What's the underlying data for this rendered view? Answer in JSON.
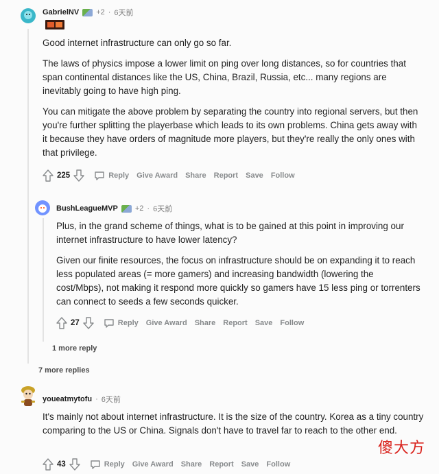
{
  "comments": [
    {
      "username": "GabrielNV",
      "flair_count": "+2",
      "time": "6天前",
      "paragraphs": [
        "Good internet infrastructure can only go so far.",
        "The laws of physics impose a lower limit on ping over long distances, so for countries that span continental distances like the US, China, Brazil, Russia, etc... many regions are inevitably going to have high ping.",
        "You can mitigate the above problem by separating the country into regional servers, but then you're further splitting the playerbase which leads to its own problems. China gets away with it because they have orders of magnitude more players, but they're really the only ones with that privilege."
      ],
      "score": "225"
    },
    {
      "username": "BushLeagueMVP",
      "flair_count": "+2",
      "time": "6天前",
      "paragraphs": [
        "Plus, in the grand scheme of things, what is to be gained at this point in improving our internet infrastructure to have lower latency?",
        "Given our finite resources, the focus on infrastructure should be on expanding it to reach less populated areas (= more gamers) and increasing bandwidth (lowering the cost/Mbps), not making it respond more quickly so gamers have 15 less ping or torrenters can connect to seeds a few seconds quicker."
      ],
      "score": "27"
    },
    {
      "username": "youeatmytofu",
      "time": "6天前",
      "paragraphs": [
        "It's mainly not about internet infrastructure. It is the size of the country. Korea as a tiny country comparing to the US or China. Signals don't have to travel far to reach to the other end."
      ],
      "score": "43"
    }
  ],
  "actions": {
    "reply": "Reply",
    "give_award": "Give Award",
    "share": "Share",
    "report": "Report",
    "save": "Save",
    "follow": "Follow"
  },
  "more_reply": "1 more reply",
  "more_replies": "7 more replies",
  "watermark": "傻大方",
  "colors": {
    "background": "#fbfbfb",
    "action_grey": "#878a8c",
    "thread_line": "#e3e3e3",
    "watermark": "#d9221c"
  }
}
